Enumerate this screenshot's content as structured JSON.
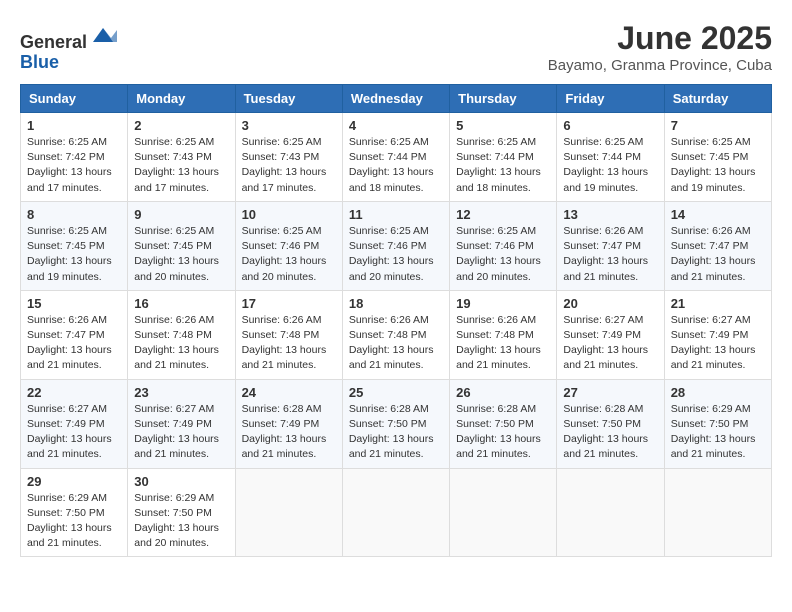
{
  "header": {
    "logo_line1": "General",
    "logo_line2": "Blue",
    "month_title": "June 2025",
    "location": "Bayamo, Granma Province, Cuba"
  },
  "weekdays": [
    "Sunday",
    "Monday",
    "Tuesday",
    "Wednesday",
    "Thursday",
    "Friday",
    "Saturday"
  ],
  "weeks": [
    [
      {
        "day": "1",
        "sunrise": "6:25 AM",
        "sunset": "7:42 PM",
        "daylight": "13 hours and 17 minutes."
      },
      {
        "day": "2",
        "sunrise": "6:25 AM",
        "sunset": "7:43 PM",
        "daylight": "13 hours and 17 minutes."
      },
      {
        "day": "3",
        "sunrise": "6:25 AM",
        "sunset": "7:43 PM",
        "daylight": "13 hours and 17 minutes."
      },
      {
        "day": "4",
        "sunrise": "6:25 AM",
        "sunset": "7:44 PM",
        "daylight": "13 hours and 18 minutes."
      },
      {
        "day": "5",
        "sunrise": "6:25 AM",
        "sunset": "7:44 PM",
        "daylight": "13 hours and 18 minutes."
      },
      {
        "day": "6",
        "sunrise": "6:25 AM",
        "sunset": "7:44 PM",
        "daylight": "13 hours and 19 minutes."
      },
      {
        "day": "7",
        "sunrise": "6:25 AM",
        "sunset": "7:45 PM",
        "daylight": "13 hours and 19 minutes."
      }
    ],
    [
      {
        "day": "8",
        "sunrise": "6:25 AM",
        "sunset": "7:45 PM",
        "daylight": "13 hours and 19 minutes."
      },
      {
        "day": "9",
        "sunrise": "6:25 AM",
        "sunset": "7:45 PM",
        "daylight": "13 hours and 20 minutes."
      },
      {
        "day": "10",
        "sunrise": "6:25 AM",
        "sunset": "7:46 PM",
        "daylight": "13 hours and 20 minutes."
      },
      {
        "day": "11",
        "sunrise": "6:25 AM",
        "sunset": "7:46 PM",
        "daylight": "13 hours and 20 minutes."
      },
      {
        "day": "12",
        "sunrise": "6:25 AM",
        "sunset": "7:46 PM",
        "daylight": "13 hours and 20 minutes."
      },
      {
        "day": "13",
        "sunrise": "6:26 AM",
        "sunset": "7:47 PM",
        "daylight": "13 hours and 21 minutes."
      },
      {
        "day": "14",
        "sunrise": "6:26 AM",
        "sunset": "7:47 PM",
        "daylight": "13 hours and 21 minutes."
      }
    ],
    [
      {
        "day": "15",
        "sunrise": "6:26 AM",
        "sunset": "7:47 PM",
        "daylight": "13 hours and 21 minutes."
      },
      {
        "day": "16",
        "sunrise": "6:26 AM",
        "sunset": "7:48 PM",
        "daylight": "13 hours and 21 minutes."
      },
      {
        "day": "17",
        "sunrise": "6:26 AM",
        "sunset": "7:48 PM",
        "daylight": "13 hours and 21 minutes."
      },
      {
        "day": "18",
        "sunrise": "6:26 AM",
        "sunset": "7:48 PM",
        "daylight": "13 hours and 21 minutes."
      },
      {
        "day": "19",
        "sunrise": "6:26 AM",
        "sunset": "7:48 PM",
        "daylight": "13 hours and 21 minutes."
      },
      {
        "day": "20",
        "sunrise": "6:27 AM",
        "sunset": "7:49 PM",
        "daylight": "13 hours and 21 minutes."
      },
      {
        "day": "21",
        "sunrise": "6:27 AM",
        "sunset": "7:49 PM",
        "daylight": "13 hours and 21 minutes."
      }
    ],
    [
      {
        "day": "22",
        "sunrise": "6:27 AM",
        "sunset": "7:49 PM",
        "daylight": "13 hours and 21 minutes."
      },
      {
        "day": "23",
        "sunrise": "6:27 AM",
        "sunset": "7:49 PM",
        "daylight": "13 hours and 21 minutes."
      },
      {
        "day": "24",
        "sunrise": "6:28 AM",
        "sunset": "7:49 PM",
        "daylight": "13 hours and 21 minutes."
      },
      {
        "day": "25",
        "sunrise": "6:28 AM",
        "sunset": "7:50 PM",
        "daylight": "13 hours and 21 minutes."
      },
      {
        "day": "26",
        "sunrise": "6:28 AM",
        "sunset": "7:50 PM",
        "daylight": "13 hours and 21 minutes."
      },
      {
        "day": "27",
        "sunrise": "6:28 AM",
        "sunset": "7:50 PM",
        "daylight": "13 hours and 21 minutes."
      },
      {
        "day": "28",
        "sunrise": "6:29 AM",
        "sunset": "7:50 PM",
        "daylight": "13 hours and 21 minutes."
      }
    ],
    [
      {
        "day": "29",
        "sunrise": "6:29 AM",
        "sunset": "7:50 PM",
        "daylight": "13 hours and 21 minutes."
      },
      {
        "day": "30",
        "sunrise": "6:29 AM",
        "sunset": "7:50 PM",
        "daylight": "13 hours and 20 minutes."
      },
      null,
      null,
      null,
      null,
      null
    ]
  ],
  "labels": {
    "sunrise": "Sunrise:",
    "sunset": "Sunset:",
    "daylight": "Daylight:"
  }
}
